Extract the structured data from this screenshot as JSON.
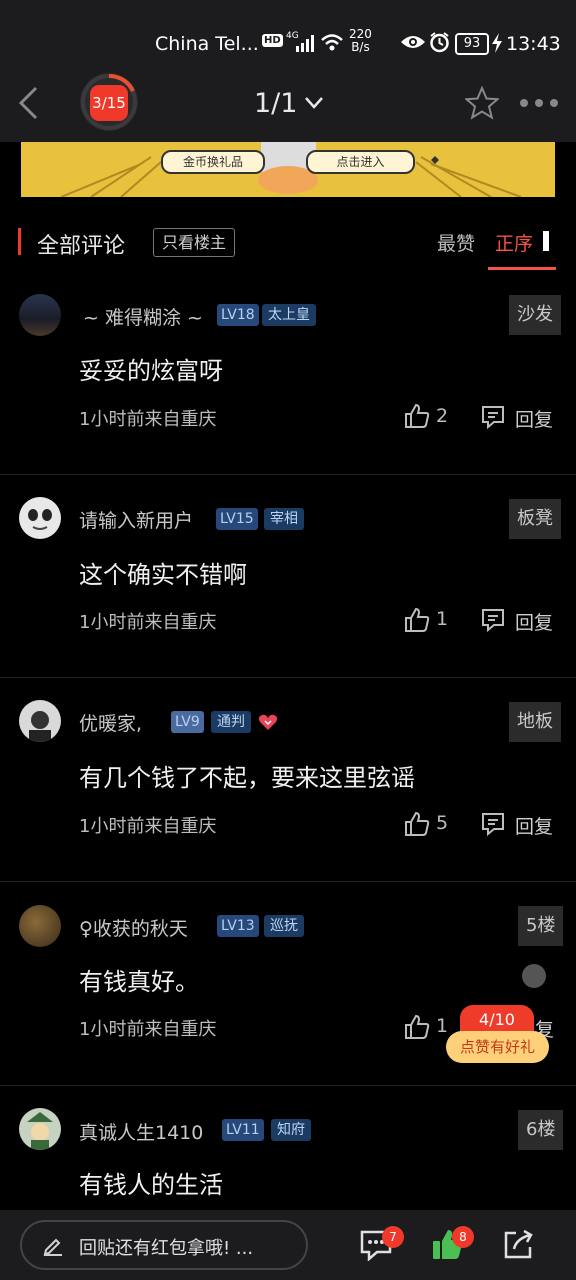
{
  "status_bar": {
    "carrier": "China Tel...",
    "hd": "HD",
    "network": "4G",
    "speed_value": "220",
    "speed_unit": "B/s",
    "battery": "93",
    "time": "13:43"
  },
  "nav": {
    "timer": "3/15",
    "page": "1/1"
  },
  "banner": {
    "left_pill": "金币换礼品",
    "right_pill": "点击进入"
  },
  "section": {
    "title": "全部评论",
    "filter_label": "只看楼主",
    "sort_hot": "最赞",
    "sort_asc": "正序"
  },
  "comments": [
    {
      "username": "~ 难得糊涂 ~",
      "level": "LV18",
      "rank": "太上皇",
      "floor": "沙发",
      "content": "妥妥的炫富呀",
      "meta": "1小时前来自重庆",
      "likes": "2",
      "reply_label": "回复"
    },
    {
      "username": "请输入新用户",
      "level": "LV15",
      "rank": "宰相",
      "floor": "板凳",
      "content": "这个确实不错啊",
      "meta": "1小时前来自重庆",
      "likes": "1",
      "reply_label": "回复"
    },
    {
      "username": "优暖家,",
      "level": "LV9",
      "rank": "通判",
      "floor": "地板",
      "content": "有几个钱了不起，要来这里弦谣",
      "meta": "1小时前来自重庆",
      "likes": "5",
      "reply_label": "回复"
    },
    {
      "username": "♀收获的秋天",
      "level": "LV13",
      "rank": "巡抚",
      "floor": "5楼",
      "content": "有钱真好。",
      "meta": "1小时前来自重庆",
      "likes": "1",
      "reply_label": "复"
    },
    {
      "username": "真诚人生1410",
      "level": "LV11",
      "rank": "知府",
      "floor": "6楼",
      "content": "有钱人的生活"
    }
  ],
  "promo": {
    "count": "4/10",
    "label": "点赞有好礼"
  },
  "bottom": {
    "reply_placeholder": "回贴还有红包拿哦! ...",
    "comment_badge": "7",
    "like_badge": "8"
  },
  "colors": {
    "accent": "#f25544",
    "level_badge": "#26487a",
    "promo": "#ef3b2a"
  }
}
